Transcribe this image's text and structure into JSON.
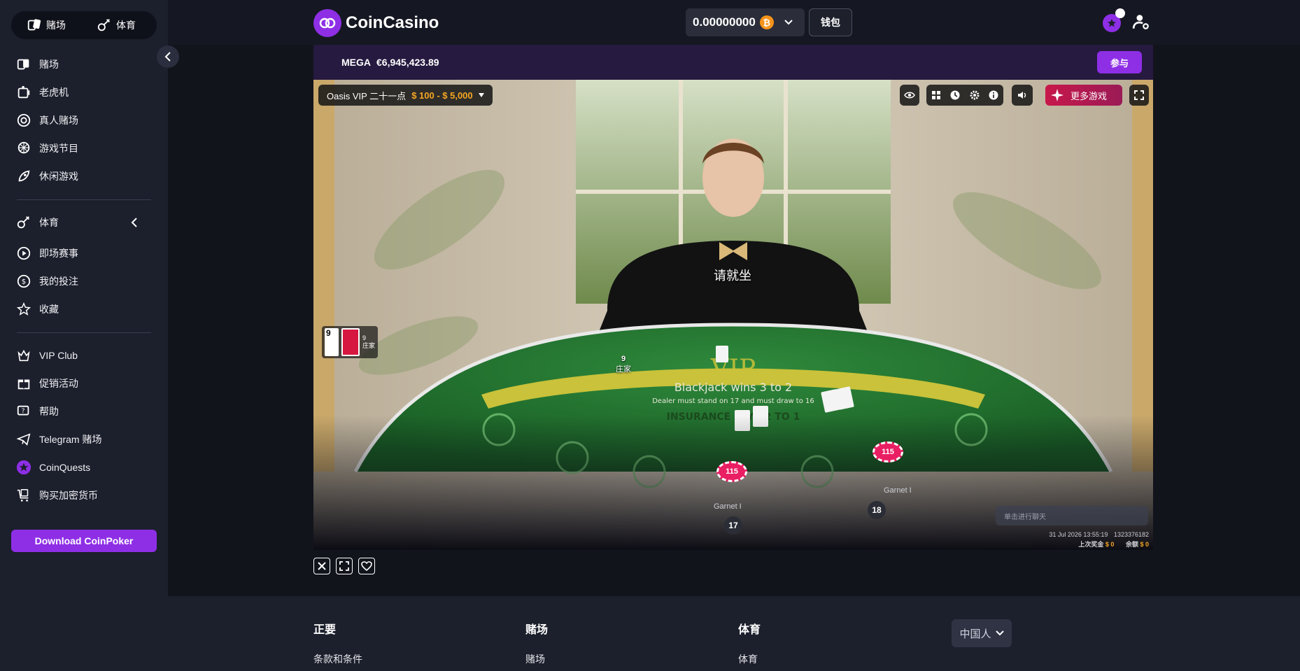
{
  "sidebar": {
    "toggle": {
      "casino": "赌场",
      "sports": "体育"
    },
    "items": [
      {
        "label": "赌场",
        "icon": "cards-icon"
      },
      {
        "label": "老虎机",
        "icon": "slot-machine-icon"
      },
      {
        "label": "真人赌场",
        "icon": "roulette-icon"
      },
      {
        "label": "游戏节目",
        "icon": "wheel-icon"
      },
      {
        "label": "休闲游戏",
        "icon": "rocket-icon"
      }
    ],
    "sports_items": [
      {
        "label": "体育",
        "icon": "sports-icon"
      },
      {
        "label": "即场赛事",
        "icon": "play-icon"
      },
      {
        "label": "我的投注",
        "icon": "bets-icon"
      },
      {
        "label": "收藏",
        "icon": "star-icon"
      }
    ],
    "extra_items": [
      {
        "label": "VIP Club",
        "icon": "vip-icon"
      },
      {
        "label": "促销活动",
        "icon": "gift-icon"
      },
      {
        "label": "帮助",
        "icon": "help-icon"
      },
      {
        "label": "Telegram 赌场",
        "icon": "telegram-icon"
      },
      {
        "label": "CoinQuests",
        "icon": "coinquests-icon"
      },
      {
        "label": "购买加密货币",
        "icon": "buy-crypto-icon"
      }
    ],
    "download_label": "Download CoinPoker"
  },
  "header": {
    "brand": "CoinCasino",
    "balance": "0.00000000",
    "currency_symbol": "₿",
    "wallet_label": "钱包"
  },
  "mega": {
    "label": "MEGA",
    "amount": "€6,945,423.89",
    "join_label": "参与"
  },
  "game": {
    "table_name": "Oasis VIP 二十一点",
    "limits": "$ 100 - $ 5,000",
    "more_games_label": "更多游戏",
    "seat_prompt": "请就坐",
    "dealer_score": "9",
    "dealer_label": "庄家",
    "card_rank": "9",
    "players": [
      {
        "name": "Garnet I",
        "score": "17",
        "chip": "115"
      },
      {
        "name": "Garnet I",
        "score": "18",
        "chip": "115"
      }
    ],
    "chat_placeholder": "单击进行聊天",
    "timestamp": "31 Jul 2026 13:55:19",
    "round_id": "1323376182",
    "last_win_label": "上次奖金",
    "last_win_value": "$ 0",
    "balance_label": "余额",
    "balance_value": "$ 0",
    "table_text": [
      "VIP",
      "Blackjack wins 3 to 2",
      "Dealer must stand on 17 and must draw to 16",
      "INSURANCE PAYS 2 TO 1"
    ]
  },
  "footer": {
    "columns": [
      {
        "heading": "正要",
        "link": "条款和条件"
      },
      {
        "heading": "赌场",
        "link": "赌场"
      },
      {
        "heading": "体育",
        "link": "体育"
      }
    ],
    "language": "中国人"
  },
  "colors": {
    "accent": "#8e2fe6",
    "gold": "#f5a623",
    "felt": "#1f6b2d"
  }
}
